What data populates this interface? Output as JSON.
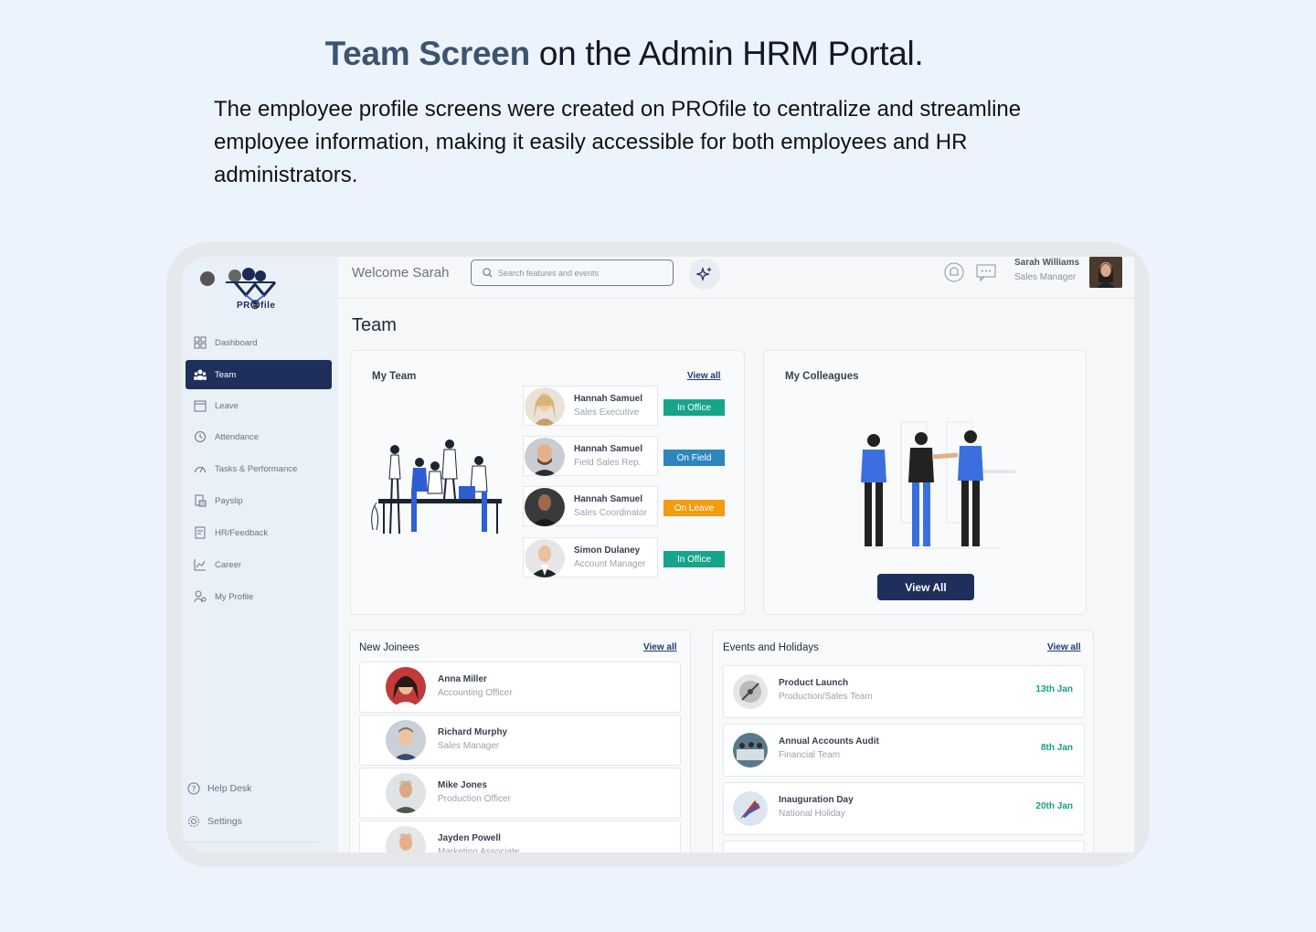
{
  "hero": {
    "title_accent": "Team Screen",
    "title_rest": " on the Admin HRM Portal.",
    "description": "The employee profile screens were created on PROfile to centralize and streamline employee information, making it easily accessible for both employees and HR administrators."
  },
  "app": {
    "logo_text": "PR🕲file",
    "welcome": "Welcome Sarah",
    "search_placeholder": "Search features and events",
    "user": {
      "name": "Sarah Williams",
      "role": "Sales Manager"
    },
    "page_title": "Team"
  },
  "sidebar": {
    "items": [
      {
        "label": "Dashboard",
        "icon": "grid-icon"
      },
      {
        "label": "Team",
        "icon": "team-icon",
        "active": true
      },
      {
        "label": "Leave",
        "icon": "calendar-icon"
      },
      {
        "label": "Attendance",
        "icon": "clock-icon"
      },
      {
        "label": "Tasks & Performance",
        "icon": "gauge-icon"
      },
      {
        "label": "Payslip",
        "icon": "payslip-icon"
      },
      {
        "label": "HR/Feedback",
        "icon": "feedback-icon"
      },
      {
        "label": "Career",
        "icon": "chart-icon"
      },
      {
        "label": "My Profile",
        "icon": "profile-icon"
      }
    ],
    "help": "Help Desk",
    "settings": "Settings"
  },
  "my_team": {
    "title": "My Team",
    "view_all": "View all",
    "members": [
      {
        "name": "Hannah Samuel",
        "role": "Sales Executive",
        "status": "In Office",
        "status_color": "#17a589"
      },
      {
        "name": "Hannah Samuel",
        "role": "Field Sales Rep.",
        "status": "On Field",
        "status_color": "#2e86c1"
      },
      {
        "name": "Hannah Samuel",
        "role": "Sales Coordinator",
        "status": "On Leave",
        "status_color": "#f39c12"
      },
      {
        "name": "Simon Dulaney",
        "role": "Account Manager",
        "status": "In Office",
        "status_color": "#17a589"
      }
    ]
  },
  "colleagues": {
    "title": "My Colleagues",
    "button": "View All"
  },
  "new_joinees": {
    "title": "New Joinees",
    "view_all": "View all",
    "items": [
      {
        "name": "Anna Miller",
        "role": "Accounting Officer"
      },
      {
        "name": "Richard Murphy",
        "role": "Sales Manager"
      },
      {
        "name": "Mike Jones",
        "role": "Production Officer"
      },
      {
        "name": "Jayden Powell",
        "role": "Marketing Associate"
      }
    ]
  },
  "events": {
    "title": "Events and Holidays",
    "view_all": "View all",
    "items": [
      {
        "name": "Product Launch",
        "sub": "Production/Sales Team",
        "date": "13th Jan"
      },
      {
        "name": "Annual Accounts Audit",
        "sub": "Financial Team",
        "date": "8th Jan"
      },
      {
        "name": "Inauguration Day",
        "sub": "National Holiday",
        "date": "20th Jan"
      }
    ]
  }
}
